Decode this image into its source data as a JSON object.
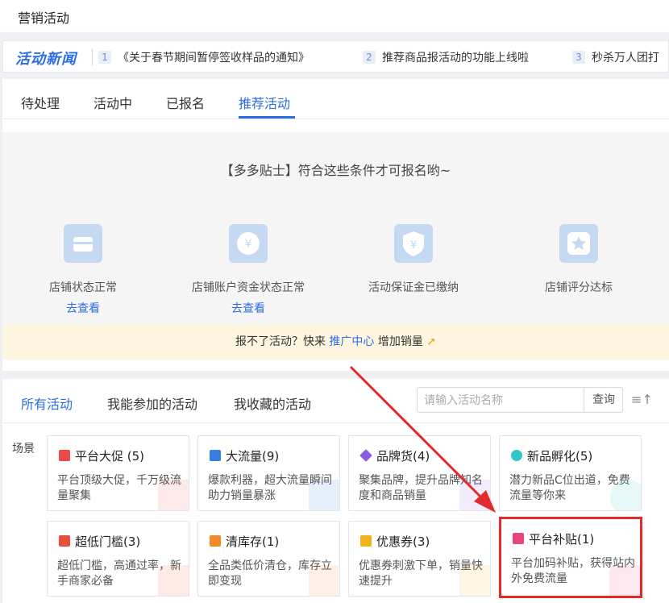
{
  "page": {
    "title": "营销活动"
  },
  "news": {
    "brand": "活动新闻",
    "items": [
      {
        "num": "1",
        "text": "《关于春节期间暂停签收样品的通知》"
      },
      {
        "num": "2",
        "text": "推荐商品报活动的功能上线啦"
      },
      {
        "num": "3",
        "text": "秒杀万人团打"
      }
    ]
  },
  "tabs": [
    "待处理",
    "活动中",
    "已报名",
    "推荐活动"
  ],
  "tips": {
    "title": "【多多贴士】符合这些条件才可报名哟~",
    "conditions": [
      {
        "label": "店铺状态正常",
        "link": "去查看",
        "icon": "store-icon"
      },
      {
        "label": "店铺账户资金状态正常",
        "link": "去查看",
        "icon": "yen-icon"
      },
      {
        "label": "活动保证金已缴纳",
        "link": "",
        "icon": "shield-yen-icon"
      },
      {
        "label": "店铺评分达标",
        "link": "",
        "icon": "star-icon"
      }
    ]
  },
  "promo": {
    "prefix": "报不了活动？快来",
    "link": "推广中心",
    "suffix": "增加销量",
    "icon": "rocket-icon"
  },
  "filter": {
    "tabs": [
      "所有活动",
      "我能参加的活动",
      "我收藏的活动"
    ],
    "search_placeholder": "请输入活动名称",
    "search_button": "查询"
  },
  "scene_label": "场景",
  "activities": [
    {
      "name": "平台大促 (5)",
      "desc": "平台顶级大促，千万级流量聚集",
      "icon": "flag-icon",
      "color": "#e84a4a"
    },
    {
      "name": "大流量(9)",
      "desc": "爆款利器，超大流量瞬间助力销量暴涨",
      "icon": "grid-icon",
      "color": "#3a7de0"
    },
    {
      "name": "品牌货(4)",
      "desc": "聚集品牌，提升品牌知名度和商品销量",
      "icon": "diamond-icon",
      "color": "#8a5ce6"
    },
    {
      "name": "新品孵化(5)",
      "desc": "潜力新品C位出道，免费流量等你来",
      "icon": "bubble-icon",
      "color": "#33c6c9"
    },
    {
      "name": "超低门槛(3)",
      "desc": "超低门槛，高通过率，新手商家必备",
      "icon": "book-icon",
      "color": "#e8503a"
    },
    {
      "name": "清库存(1)",
      "desc": "全品类低价清仓，库存立即变现",
      "icon": "box-icon",
      "color": "#f08a2c"
    },
    {
      "name": "优惠券(3)",
      "desc": "优惠券刺激下单，销量快速提升",
      "icon": "coupon-icon",
      "color": "#f2b21b"
    },
    {
      "name": "平台补贴(1)",
      "desc": "平台加码补贴，获得站内外免费流量",
      "icon": "shop-icon",
      "color": "#e8457a"
    }
  ],
  "colors": {
    "accent": "#2b6de5",
    "highlight": "#e32929"
  }
}
